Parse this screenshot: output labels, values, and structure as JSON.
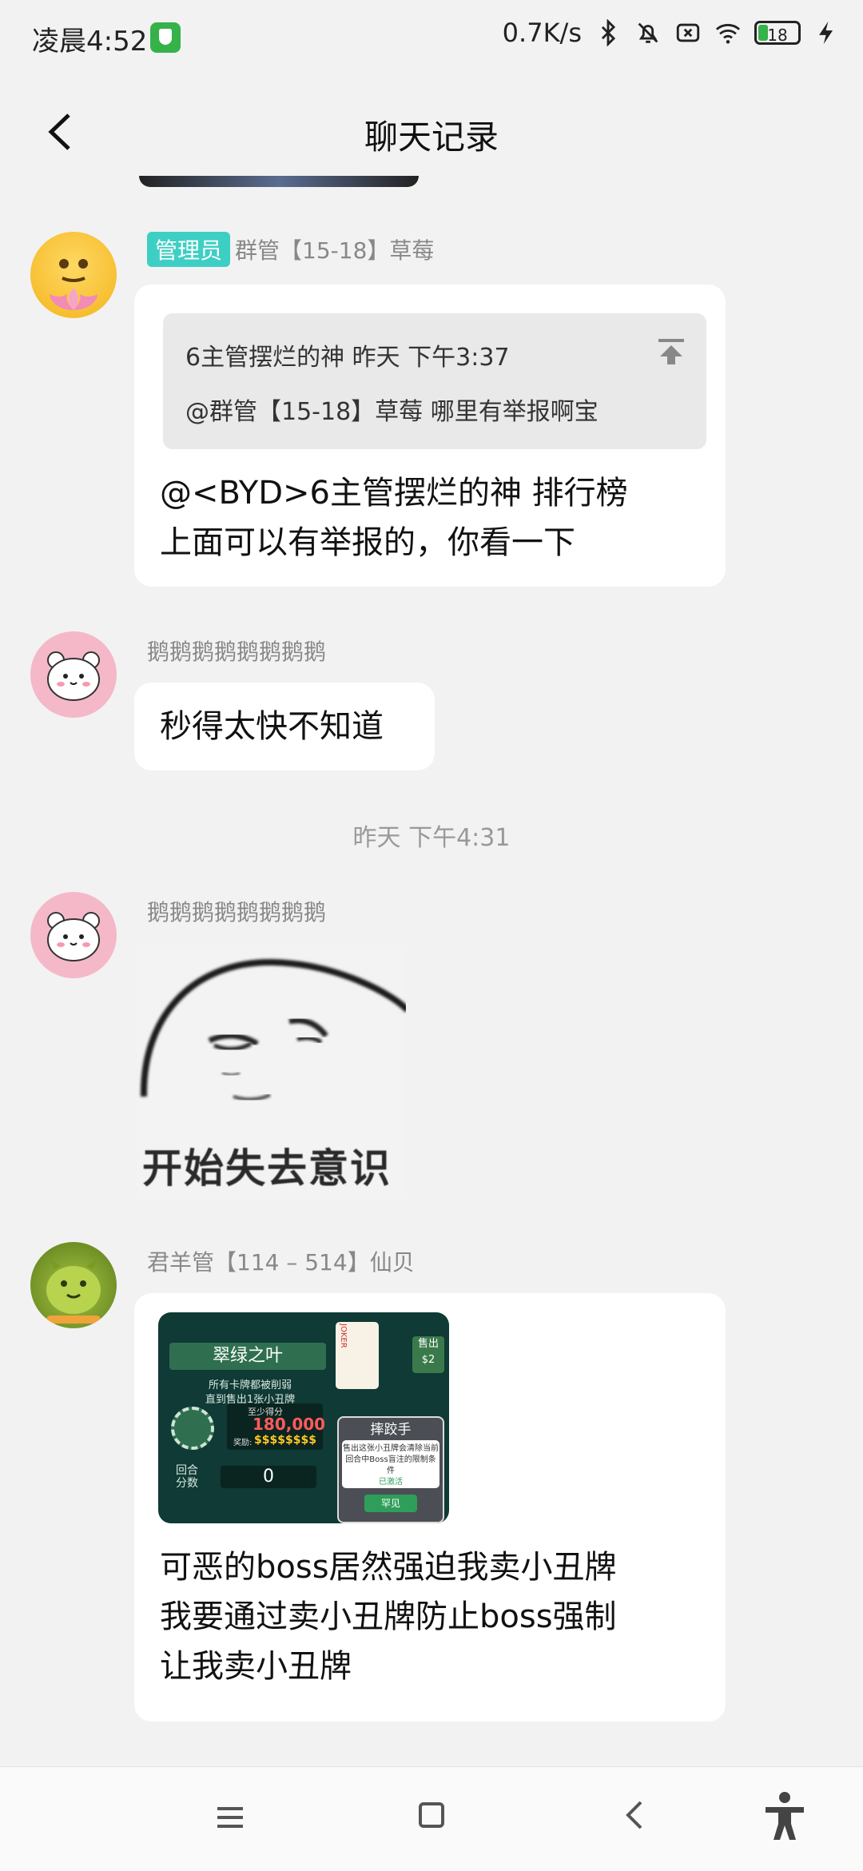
{
  "status_bar": {
    "time": "凌晨4:52",
    "net_speed": "0.7K/s",
    "battery": "18"
  },
  "header": {
    "title": "聊天记录"
  },
  "messages": [
    {
      "badge": "管理员",
      "sender": "群管【15-18】草莓",
      "quote_line1": "6主管摆烂的神  昨天 下午3:37",
      "quote_line2": "@群管【15-18】草莓 哪里有举报啊宝",
      "text_line1": "@<BYD>6主管摆烂的神 排行榜",
      "text_line2": "上面可以有举报的，你看一下"
    },
    {
      "sender": "鹅鹅鹅鹅鹅鹅鹅鹅",
      "text": "秒得太快不知道"
    },
    {
      "sender": "鹅鹅鹅鹅鹅鹅鹅鹅",
      "sticker_caption": "开始失去意识"
    },
    {
      "sender": "君羊管【114 – 514】仙贝",
      "game": {
        "title": "翠绿之叶",
        "sub1": "所有卡牌都被削弱",
        "sub2": "直到售出1张小丑牌",
        "min_label": "至少得分",
        "score": "180,000",
        "reward_label": "奖励:",
        "reward": "$$$$$$$$",
        "round_label": "回合分数",
        "round_value": "0",
        "joker": "JOKER",
        "sell": "售出 $2",
        "lose_title": "摔跤手",
        "lose_desc": "售出这张小丑牌会清除当前回合中Boss盲注的限制条件",
        "lose_status": "已激活",
        "lose_rarity": "罕见"
      },
      "text_line1": "可恶的boss居然强迫我卖小丑牌",
      "text_line2": "我要通过卖小丑牌防止boss强制",
      "text_line3": "让我卖小丑牌"
    }
  ],
  "divider_time": "昨天 下午4:31",
  "colors": {
    "admin_badge": "#3ecfc4",
    "background": "#f2f2f2",
    "bubble": "#ffffff"
  }
}
